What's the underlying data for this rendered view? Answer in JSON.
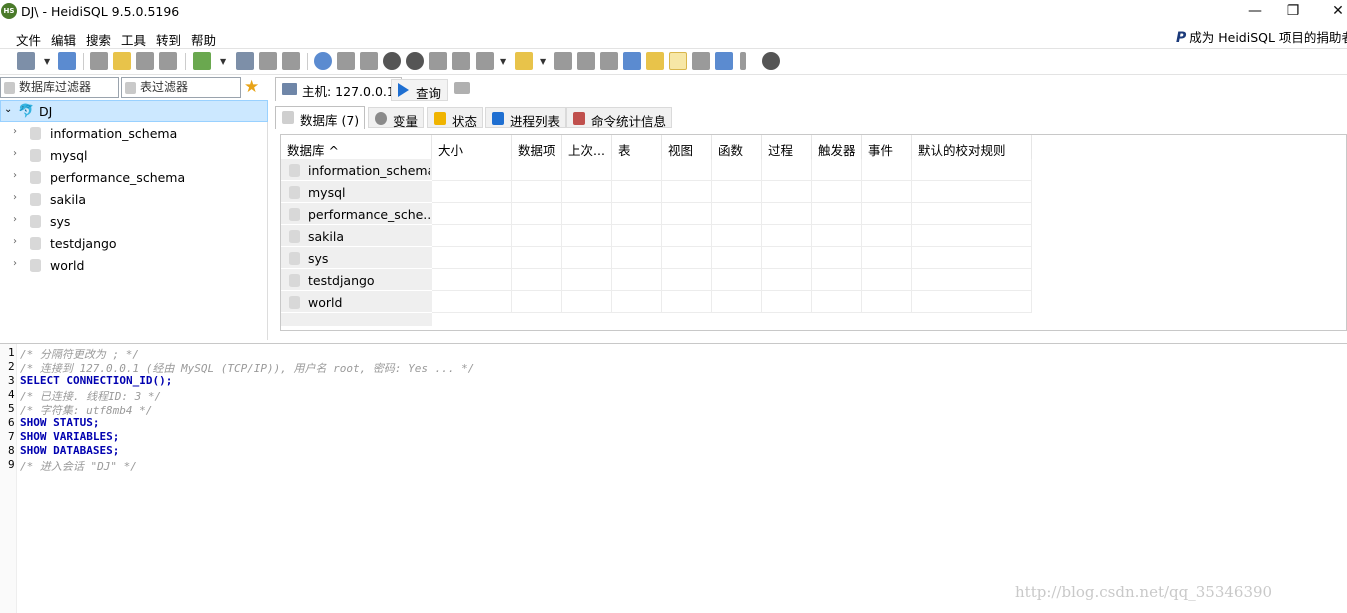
{
  "window": {
    "title": "DJ\\ - HeidiSQL 9.5.0.5196",
    "app_icon_text": "HS",
    "controls": [
      "—",
      "❐",
      "✕"
    ]
  },
  "menu": {
    "items": [
      "文件",
      "编辑",
      "搜索",
      "工具",
      "转到",
      "帮助"
    ],
    "donate": "成为 HeidiSQL 项目的捐助者"
  },
  "filters": {
    "db_filter_placeholder": "数据库过滤器",
    "table_filter_placeholder": "表过滤器"
  },
  "tree": {
    "root": "DJ",
    "databases": [
      "information_schema",
      "mysql",
      "performance_schema",
      "sakila",
      "sys",
      "testdjango",
      "world"
    ]
  },
  "tabs": {
    "host": "主机: 127.0.0.1",
    "query": "查询",
    "subtabs": [
      "数据库 (7)",
      "变量",
      "状态",
      "进程列表",
      "命令统计信息"
    ]
  },
  "grid": {
    "columns": [
      "数据库 ^",
      "大小",
      "数据项",
      "上次...",
      "表",
      "视图",
      "函数",
      "过程",
      "触发器",
      "事件",
      "默认的校对规则"
    ],
    "rows": [
      "information_schema",
      "mysql",
      "performance_sche...",
      "sakila",
      "sys",
      "testdjango",
      "world"
    ]
  },
  "editor": {
    "lines": [
      {
        "n": "1",
        "t": "/* 分隔符更改为 ; */",
        "kind": "cmt"
      },
      {
        "n": "2",
        "t": "/* 连接到 127.0.0.1 (经由 MySQL (TCP/IP)), 用户名 root, 密码: Yes ... */",
        "kind": "cmt"
      },
      {
        "n": "3",
        "t": "SELECT CONNECTION_ID();",
        "kind": "kw"
      },
      {
        "n": "4",
        "t": "/* 已连接. 线程ID: 3 */",
        "kind": "cmt"
      },
      {
        "n": "5",
        "t": "/* 字符集: utf8mb4 */",
        "kind": "cmt"
      },
      {
        "n": "6",
        "t": "SHOW STATUS;",
        "kind": "kw"
      },
      {
        "n": "7",
        "t": "SHOW VARIABLES;",
        "kind": "kw"
      },
      {
        "n": "8",
        "t": "SHOW DATABASES;",
        "kind": "kw"
      },
      {
        "n": "9",
        "t": "/* 进入会话 \"DJ\" */",
        "kind": "cmt"
      }
    ]
  },
  "watermark": "http://blog.csdn.net/qq_35346390"
}
